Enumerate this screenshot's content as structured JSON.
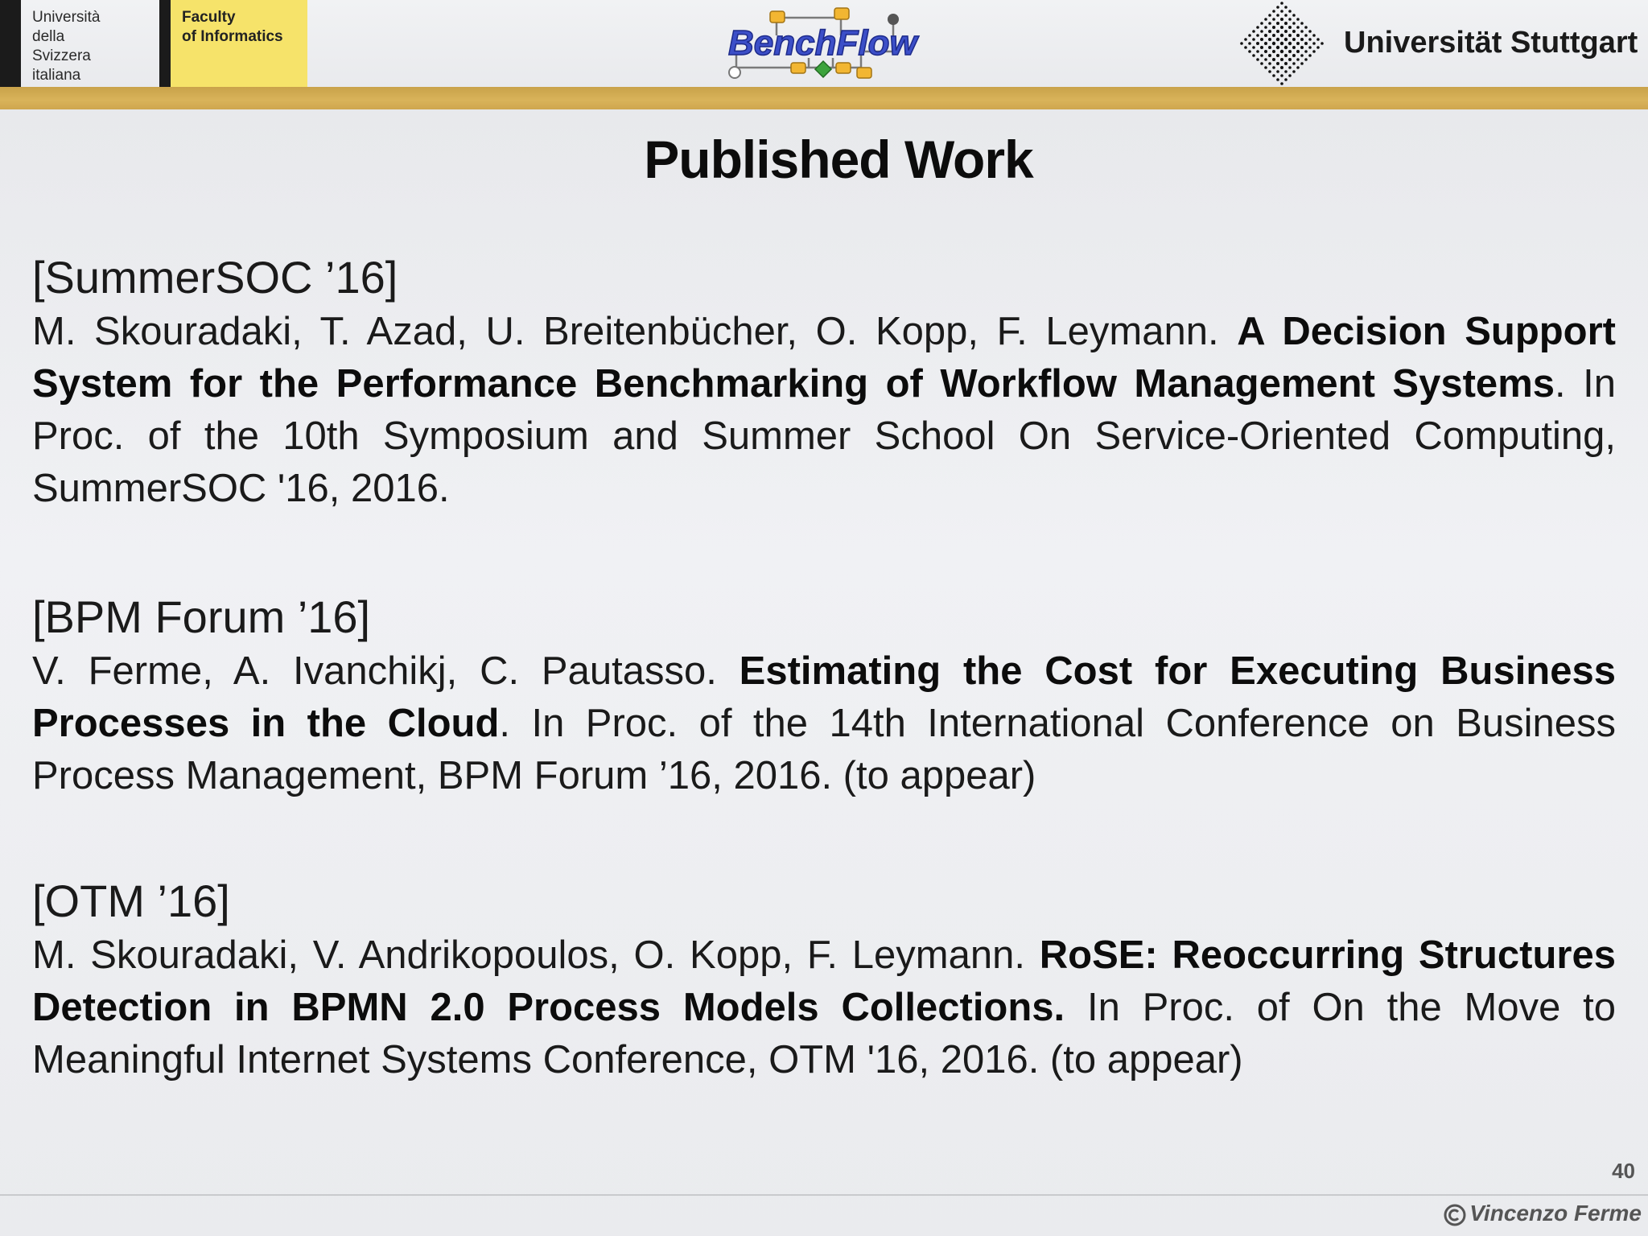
{
  "header": {
    "usi_lines": [
      "Università",
      "della",
      "Svizzera",
      "italiana"
    ],
    "faculty_lines": [
      "Faculty",
      "of Informatics"
    ],
    "benchflow_logo_text": "BenchFlow",
    "uni_stuttgart": "Universität Stuttgart"
  },
  "slide": {
    "title": "Published Work",
    "page_number": "40",
    "author": "Vincenzo Ferme"
  },
  "publications": [
    {
      "tag": "[SummerSOC ’16]",
      "authors": "M. Skouradaki, T. Azad, U. Breitenbücher, O. Kopp, F. Leymann. ",
      "title": "A Decision Support System for the Performance Benchmarking of Workflow Management Systems",
      "venue": ". In Proc. of the 10th Symposium and Summer School On Service-Oriented Computing, SummerSOC '16, 2016."
    },
    {
      "tag": "[BPM Forum ’16]",
      "authors": "V. Ferme, A. Ivanchikj, C. Pautasso. ",
      "title": "Estimating the Cost for Executing Business Processes in the Cloud",
      "venue": ". In Proc. of the 14th International Conference on Business Process Management, BPM Forum ’16, 2016. (to appear)"
    },
    {
      "tag": "[OTM ’16]",
      "authors": "M. Skouradaki, V. Andrikopoulos, O. Kopp, F. Leymann. ",
      "title": "RoSE: Reoccurring Structures Detection in BPMN 2.0 Process Models Collections.",
      "venue": " In Proc. of On the Move to Meaningful Internet Systems Conference, OTM '16,  2016. (to appear)"
    }
  ],
  "colors": {
    "gold_bar": "#d4ad55",
    "faculty_yellow": "#f6e36a",
    "benchflow_blue": "#3c4fc8"
  }
}
